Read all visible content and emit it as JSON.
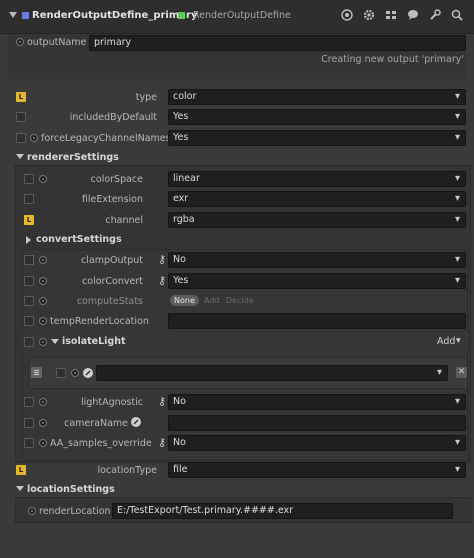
{
  "header": {
    "title": "RenderOutputDefine_primary",
    "node_type": "RenderOutputDefine",
    "icons": [
      "record-icon",
      "gear-icon",
      "grid-icon",
      "comment-icon",
      "wrench-icon",
      "search-icon"
    ]
  },
  "output_name": {
    "label": "outputName",
    "value": "primary",
    "status": "Creating new output 'primary'"
  },
  "type": {
    "label": "type",
    "value": "color"
  },
  "included_by_default": {
    "label": "includedByDefault",
    "value": "Yes"
  },
  "force_legacy": {
    "label": "forceLegacyChannelNames",
    "value": "Yes"
  },
  "renderer_settings": {
    "title": "rendererSettings",
    "color_space": {
      "label": "colorSpace",
      "value": "linear"
    },
    "file_extension": {
      "label": "fileExtension",
      "value": "exr"
    },
    "channel": {
      "label": "channel",
      "value": "rgba"
    },
    "convert_settings": {
      "title": "convertSettings",
      "clamp_output": {
        "label": "clampOutput",
        "value": "No"
      },
      "color_convert": {
        "label": "colorConvert",
        "value": "Yes"
      },
      "compute_stats": {
        "label": "computeStats",
        "options": [
          "None",
          "Add",
          "Decide"
        ],
        "selected": "None"
      },
      "temp_render_location": {
        "label": "tempRenderLocation",
        "value": ""
      },
      "isolate_light": {
        "title": "isolateLight",
        "add_label": "Add",
        "entry_value": ""
      },
      "light_agnostic": {
        "label": "lightAgnostic",
        "value": "No"
      },
      "camera_name": {
        "label": "cameraName",
        "value": ""
      },
      "aa_samples_override": {
        "label": "AA_samples_override",
        "value": "No"
      }
    }
  },
  "location_type": {
    "label": "locationType",
    "value": "file"
  },
  "location_settings": {
    "title": "locationSettings",
    "render_location": {
      "label": "renderLocation",
      "value": "E:/TestExport/Test.primary.####.exr"
    }
  },
  "colors": {
    "badge": "#e5b72a",
    "node_purple": "#6c7bd6",
    "node_green": "#5ec85e"
  }
}
